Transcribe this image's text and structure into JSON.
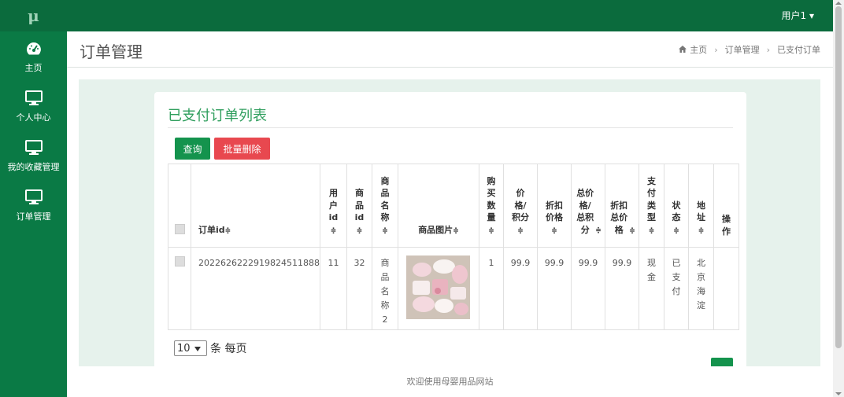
{
  "app": {
    "logo_text": "μ"
  },
  "sidebar": {
    "items": [
      {
        "label": "主页",
        "icon": "dashboard-icon"
      },
      {
        "label": "个人中心",
        "icon": "monitor-icon"
      },
      {
        "label": "我的收藏管理",
        "icon": "monitor-icon"
      },
      {
        "label": "订单管理",
        "icon": "monitor-icon"
      }
    ]
  },
  "topbar": {
    "user_label": "用户1 ▾"
  },
  "header": {
    "title": "订单管理",
    "breadcrumb": {
      "home_icon": "home-icon",
      "home": "主页",
      "section": "订单管理",
      "current": "已支付订单",
      "separator": "›"
    }
  },
  "card": {
    "title": "已支付订单列表",
    "query_label": "查询",
    "batch_delete_label": "批量删除"
  },
  "table": {
    "sort_glyph": "≑",
    "headers": {
      "order_id": "订单id",
      "user_id": "用户id",
      "product_id": "商品id",
      "product_name": "商品名称",
      "product_image": "商品图片",
      "quantity": "购买数量",
      "price": "价格/积分",
      "discount_price": "折扣价格",
      "total": "总价格/总积分",
      "discount_total": "折扣总价格",
      "pay_type": "支付类型",
      "status": "状态",
      "address": "地址",
      "action": "操作"
    },
    "rows": [
      {
        "order_id": "2022626222919824511888",
        "user_id": "11",
        "product_id": "32",
        "product_name": "商品名称2",
        "quantity": "1",
        "price": "99.9",
        "discount_price": "99.9",
        "total": "99.9",
        "discount_total": "99.9",
        "pay_type": "现金",
        "status": "已支付",
        "address": "北京海淀"
      }
    ]
  },
  "pager": {
    "page_size": "10",
    "per_page_label": "条 每页"
  },
  "footer": {
    "text": "欢迎使用母婴用品网站"
  },
  "colors": {
    "sidebar": "#0a7a45",
    "topbar": "#0b6b3d",
    "accent": "#14934d",
    "danger": "#e8484f",
    "title_green": "#2f9e5d"
  }
}
